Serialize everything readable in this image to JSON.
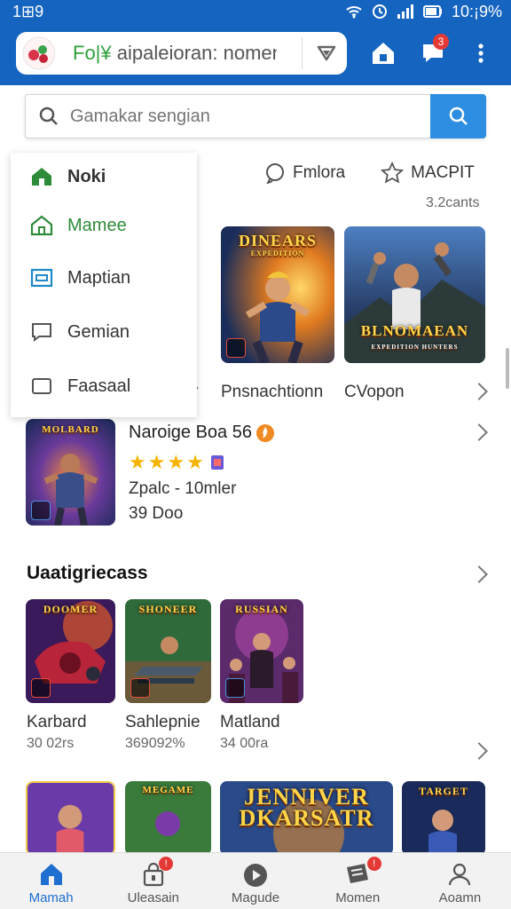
{
  "status": {
    "time_left": "1⊞9",
    "time_right": "10:¡9%"
  },
  "appbar": {
    "url_green": "Fo|¥",
    "url_rest": " aipaleioran: nomenl",
    "notif_count": "3"
  },
  "search": {
    "placeholder": "Gamakar sengian"
  },
  "drawer": {
    "items": [
      {
        "label": "Noki",
        "icon": "home-icon"
      },
      {
        "label": "Mamee",
        "icon": "home-icon"
      },
      {
        "label": "Maptian",
        "icon": "window-icon"
      },
      {
        "label": "Gemian",
        "icon": "chat-icon"
      },
      {
        "label": "Faasaal",
        "icon": "square-icon"
      }
    ]
  },
  "tabs": [
    {
      "label": "Fmlora",
      "icon": "chat-bubble-icon"
    },
    {
      "label": "MACPIT",
      "icon": "star-icon"
    }
  ],
  "tab_sub": "3.2cants",
  "top_games": [
    {
      "title": "DINEARS",
      "sub": "EXPEDITION",
      "caption": "Pnsnachtionn"
    },
    {
      "title": "BLNOMAEAN",
      "sub": "EXPEDITION HUNTERS",
      "caption": "CVopon"
    }
  ],
  "featured": {
    "title": "Naroige Boa 56",
    "art_title": "MOLBARD",
    "rating": 4,
    "line1": "Zpalc - 10mler",
    "line2": "39 Doo"
  },
  "section": {
    "title": "Uaatigriecass",
    "games": [
      {
        "art": "DOOMER",
        "name": "Karbard",
        "meta": "30 02rs"
      },
      {
        "art": "SHONEER",
        "name": "Sahlepnie",
        "meta": "369092%"
      },
      {
        "art": "RUSSIAN",
        "name": "Matland",
        "meta": "34 00ra"
      }
    ]
  },
  "bottom_row": [
    {
      "art": ""
    },
    {
      "art": "MEGAME"
    },
    {
      "art": "JENNIVER DKARSATR"
    },
    {
      "art": "TARGET"
    }
  ],
  "bottomnav": [
    {
      "label": "Mamah",
      "icon": "home-icon",
      "active": true
    },
    {
      "label": "Uleasain",
      "icon": "lock-icon",
      "badge": "!"
    },
    {
      "label": "Magude",
      "icon": "play-icon"
    },
    {
      "label": "Momen",
      "icon": "card-icon",
      "badge": "!"
    },
    {
      "label": "Aoamn",
      "icon": "user-icon"
    }
  ],
  "colors": {
    "primary": "#1565c0",
    "accent": "#2d8de0",
    "active_green": "#2e8b3a",
    "badge_red": "#e53935",
    "star": "#f5b400"
  }
}
